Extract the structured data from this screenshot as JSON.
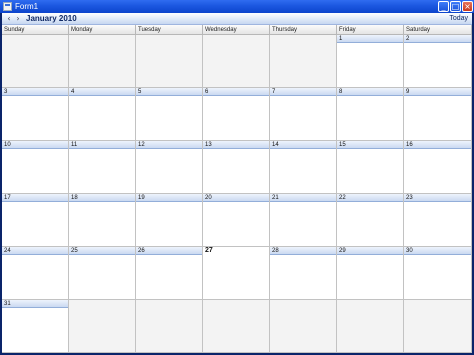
{
  "window": {
    "title": "Form1",
    "minimize_glyph": "_",
    "maximize_glyph": "□",
    "close_glyph": "×"
  },
  "nav": {
    "prev_glyph": "‹",
    "next_glyph": "›",
    "month": "January 2010",
    "today_label": "Today"
  },
  "day_names": [
    "Sunday",
    "Monday",
    "Tuesday",
    "Wednesday",
    "Thursday",
    "Friday",
    "Saturday"
  ],
  "weeks": [
    [
      "",
      "",
      "",
      "",
      "",
      "1",
      "2"
    ],
    [
      "3",
      "4",
      "5",
      "6",
      "7",
      "8",
      "9"
    ],
    [
      "10",
      "11",
      "12",
      "13",
      "14",
      "15",
      "16"
    ],
    [
      "17",
      "18",
      "19",
      "20",
      "21",
      "22",
      "23"
    ],
    [
      "24",
      "25",
      "26",
      "27",
      "28",
      "29",
      "30"
    ],
    [
      "31",
      "",
      "",
      "",
      "",
      "",
      ""
    ]
  ],
  "today_day": "27"
}
